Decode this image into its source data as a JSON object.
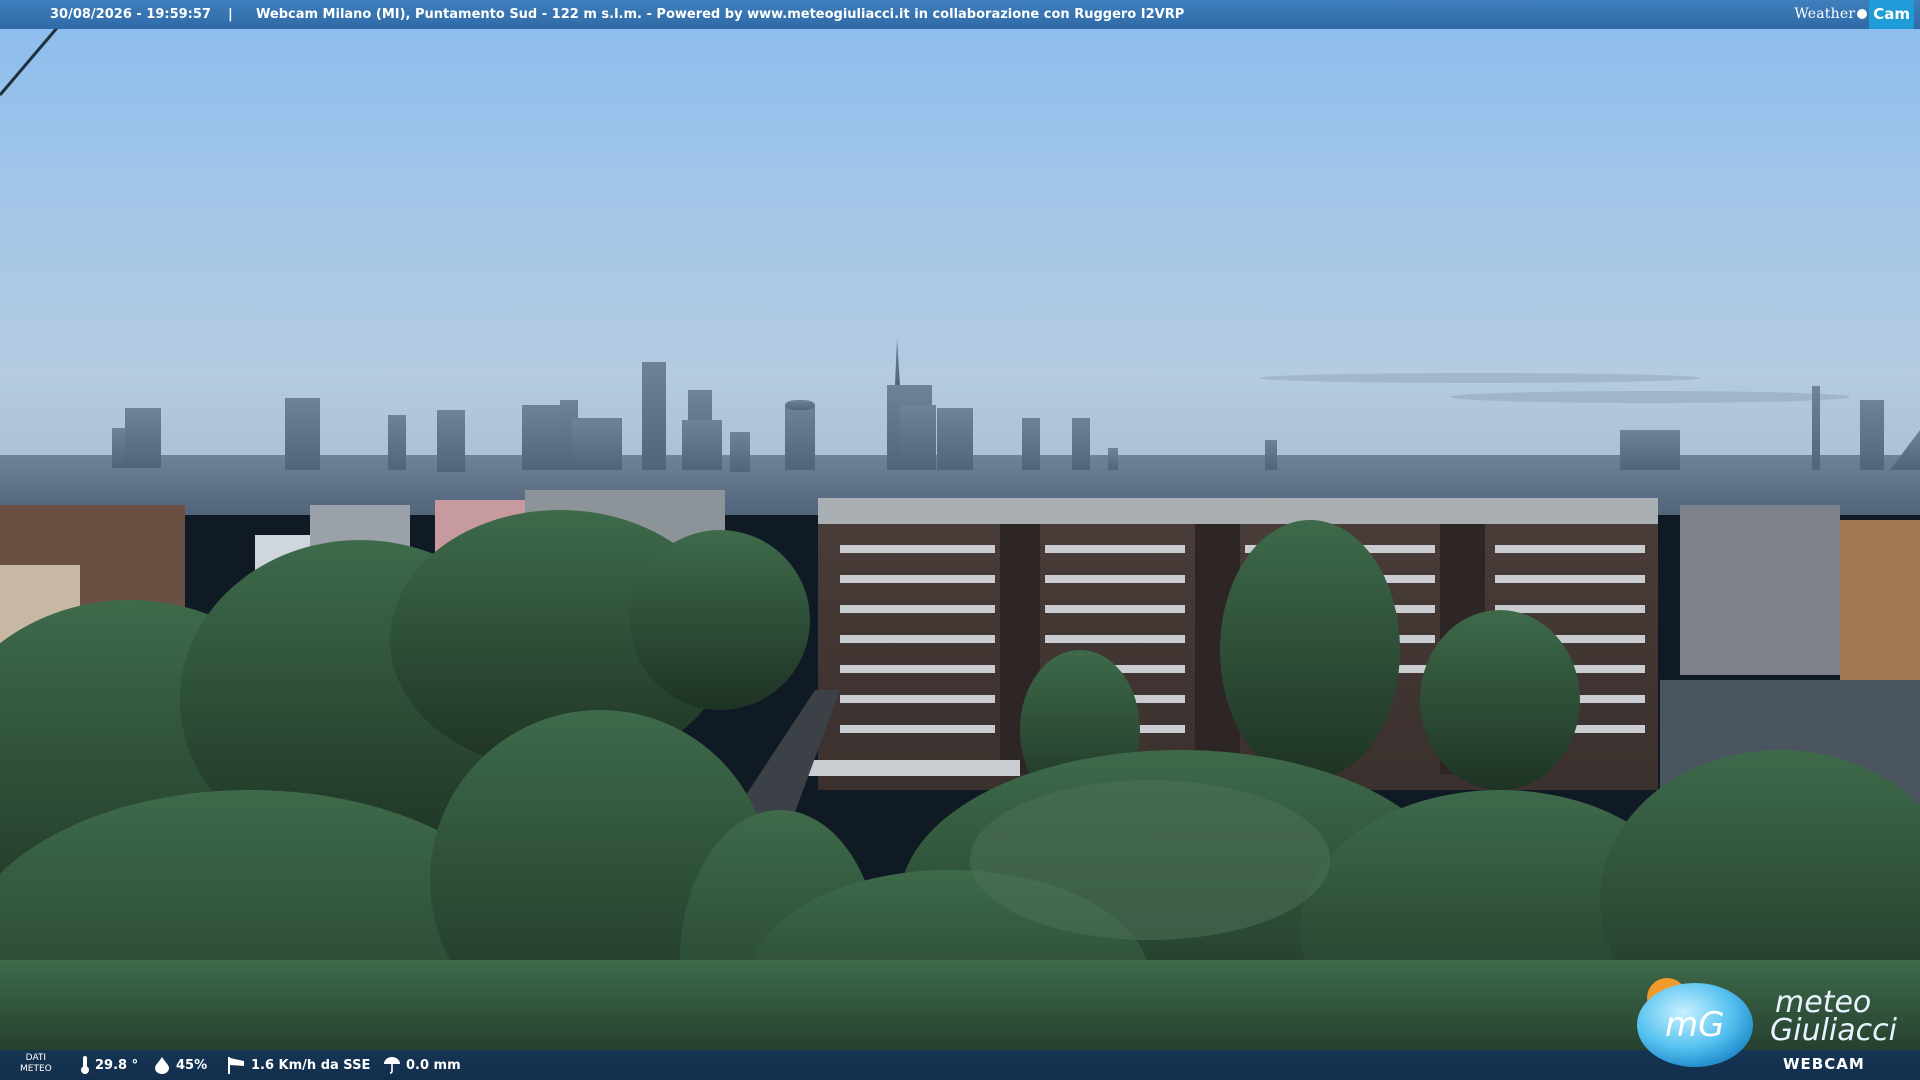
{
  "top_bar": {
    "timestamp": "30/08/2026 - 19:59:57",
    "separator": "|",
    "caption": "Webcam Milano (MI), Puntamento Sud - 122 m s.l.m. - Powered by www.meteogiuliacci.it in collaborazione con Ruggero I2VRP",
    "brand_left": "Weather",
    "brand_right": "Cam"
  },
  "bottom_bar": {
    "data_label_line1": "DATI",
    "data_label_line2": "METEO",
    "temperature": "29.8 °",
    "humidity": "45%",
    "wind": "1.6 Km/h da SSE",
    "rain": "0.0 mm",
    "temperature_icon": "thermometer-icon",
    "humidity_icon": "drop-icon",
    "wind_icon": "windsock-icon",
    "rain_icon": "umbrella-icon"
  },
  "logo": {
    "badge": "mG",
    "line1": "meteo",
    "line2": "Giuliacci",
    "line3": "WEBCAM"
  },
  "colors": {
    "sky_top": "#8fbfee",
    "sky_horizon": "#b2c9dd",
    "bar_blue": "#3a78b6",
    "foliage": "#2c4a33"
  }
}
